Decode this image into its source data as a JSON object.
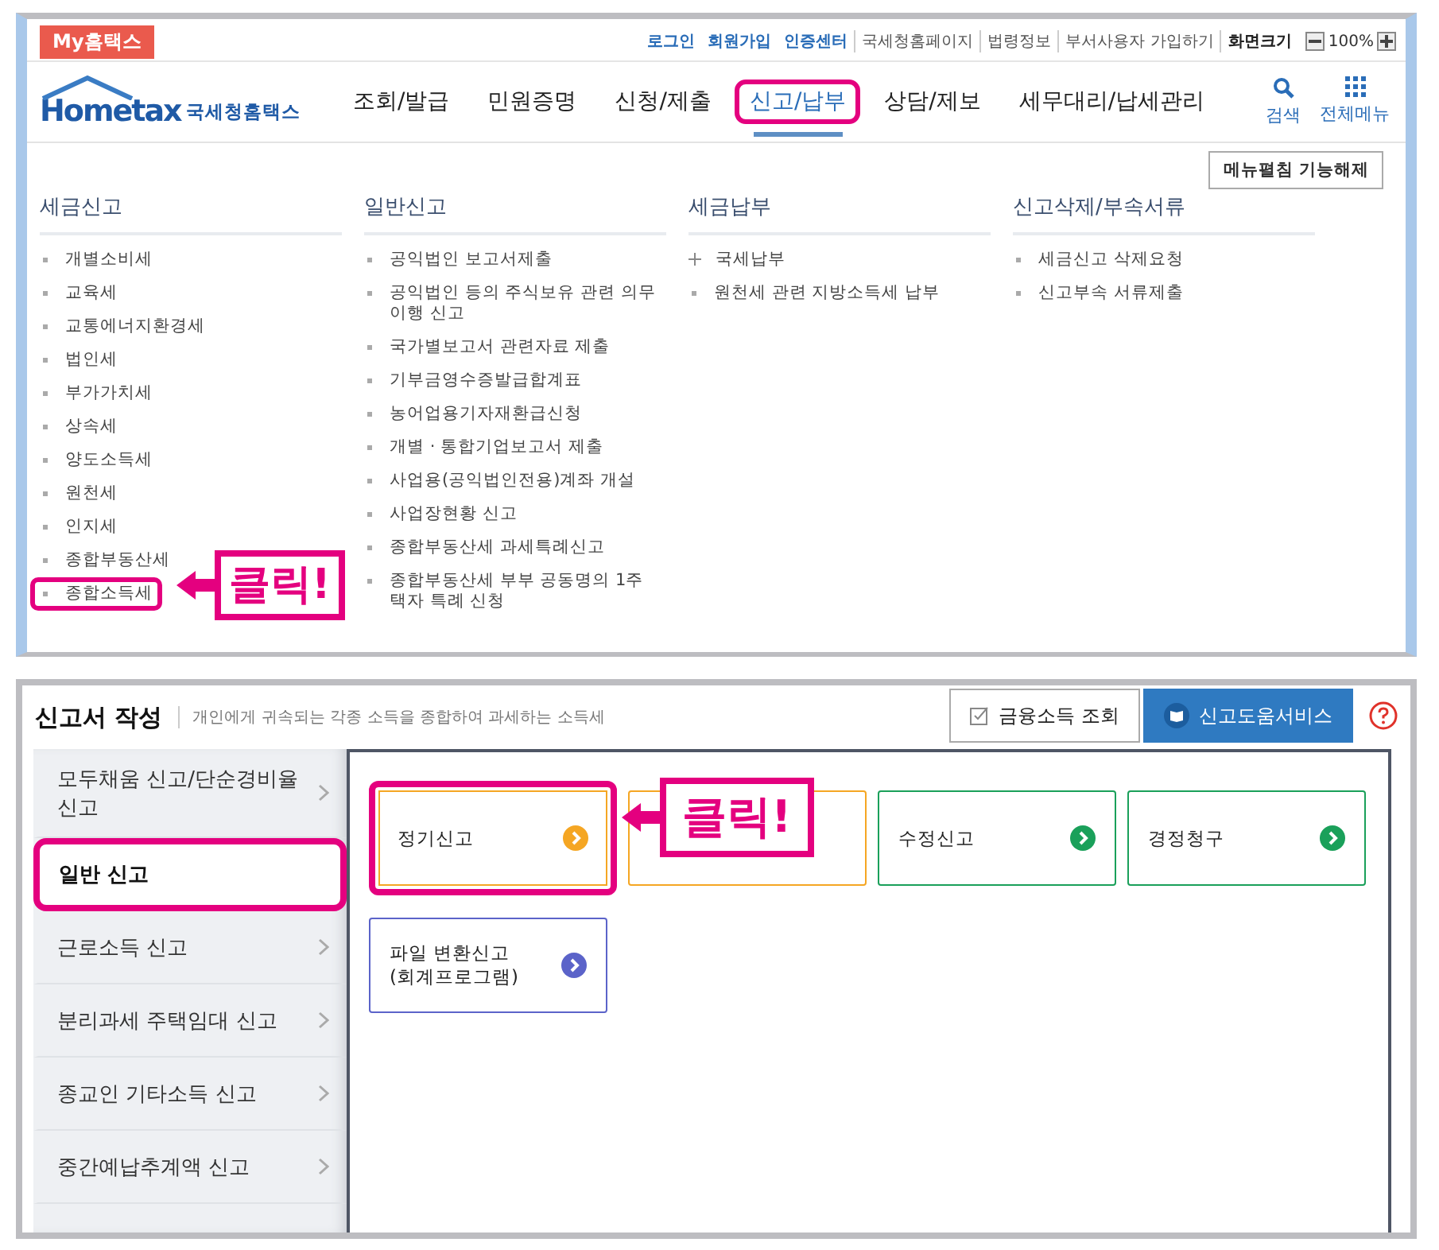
{
  "header": {
    "badge": "My홈택스",
    "top_links": [
      {
        "label": "로그인",
        "kind": "accent"
      },
      {
        "label": "회원가입",
        "kind": "accent"
      },
      {
        "label": "인증센터",
        "kind": "accent"
      },
      {
        "label": "국세청홈페이지",
        "kind": "plain"
      },
      {
        "label": "법령정보",
        "kind": "plain"
      },
      {
        "label": "부서사용자 가입하기",
        "kind": "plain"
      },
      {
        "label": "화면크기",
        "kind": "strong"
      }
    ],
    "zoom_value": "100%"
  },
  "logo": {
    "name": "Hometax",
    "korean": "국세청홈택스"
  },
  "nav": [
    {
      "label": "조회/발급",
      "selected": false,
      "highlighted": false
    },
    {
      "label": "민원증명",
      "selected": false,
      "highlighted": false
    },
    {
      "label": "신청/제출",
      "selected": false,
      "highlighted": false
    },
    {
      "label": "신고/납부",
      "selected": true,
      "highlighted": true
    },
    {
      "label": "상담/제보",
      "selected": false,
      "highlighted": false
    },
    {
      "label": "세무대리/납세관리",
      "selected": false,
      "highlighted": false
    }
  ],
  "tools": [
    {
      "label": "검색",
      "kind": "search"
    },
    {
      "label": "전체메뉴",
      "kind": "grid"
    }
  ],
  "menu_toggle": "메뉴펼침 기능해제",
  "menu_columns": [
    {
      "title": "세금신고",
      "items": [
        {
          "label": "개별소비세",
          "kind": "dot",
          "highlighted": false
        },
        {
          "label": "교육세",
          "kind": "dot",
          "highlighted": false
        },
        {
          "label": "교통에너지환경세",
          "kind": "dot",
          "highlighted": false
        },
        {
          "label": "법인세",
          "kind": "dot",
          "highlighted": false
        },
        {
          "label": "부가가치세",
          "kind": "dot",
          "highlighted": false
        },
        {
          "label": "상속세",
          "kind": "dot",
          "highlighted": false
        },
        {
          "label": "양도소득세",
          "kind": "dot",
          "highlighted": false
        },
        {
          "label": "원천세",
          "kind": "dot",
          "highlighted": false
        },
        {
          "label": "인지세",
          "kind": "dot",
          "highlighted": false
        },
        {
          "label": "종합부동산세",
          "kind": "dot",
          "highlighted": false
        },
        {
          "label": "종합소득세",
          "kind": "dot",
          "highlighted": true
        }
      ]
    },
    {
      "title": "일반신고",
      "items": [
        {
          "label": "공익법인 보고서제출",
          "kind": "dot",
          "highlighted": false
        },
        {
          "label": "공익법인 등의 주식보유 관련 의무이행 신고",
          "kind": "dot",
          "highlighted": false
        },
        {
          "label": "국가별보고서 관련자료 제출",
          "kind": "dot",
          "highlighted": false
        },
        {
          "label": "기부금영수증발급합계표",
          "kind": "dot",
          "highlighted": false
        },
        {
          "label": "농어업용기자재환급신청",
          "kind": "dot",
          "highlighted": false
        },
        {
          "label": "개별 · 통합기업보고서 제출",
          "kind": "dot",
          "highlighted": false
        },
        {
          "label": "사업용(공익법인전용)계좌 개설",
          "kind": "dot",
          "highlighted": false
        },
        {
          "label": "사업장현황 신고",
          "kind": "dot",
          "highlighted": false
        },
        {
          "label": "종합부동산세 과세특례신고",
          "kind": "dot",
          "highlighted": false
        },
        {
          "label": "종합부동산세 부부 공동명의 1주택자 특례 신청",
          "kind": "dot",
          "highlighted": false
        }
      ]
    },
    {
      "title": "세금납부",
      "items": [
        {
          "label": "국세납부",
          "kind": "plus",
          "highlighted": false
        },
        {
          "label": "원천세 관련 지방소득세 납부",
          "kind": "dot",
          "highlighted": false
        }
      ]
    },
    {
      "title": "신고삭제/부속서류",
      "items": [
        {
          "label": "세금신고 삭제요청",
          "kind": "dot",
          "highlighted": false
        },
        {
          "label": "신고부속 서류제출",
          "kind": "dot",
          "highlighted": false
        }
      ]
    }
  ],
  "callouts": [
    {
      "text": "클릭!"
    },
    {
      "text": "클릭!"
    }
  ],
  "form": {
    "title": "신고서 작성",
    "description": "개인에게 귀속되는 각종 소득을 종합하여 과세하는 소득세",
    "buttons": [
      {
        "label": "금융소득 조회",
        "kind": "check"
      },
      {
        "label": "신고도움서비스",
        "kind": "book"
      }
    ]
  },
  "side_menu": [
    {
      "label": "모두채움 신고/단순경비율 신고",
      "selected": false,
      "highlighted": false
    },
    {
      "label": "일반 신고",
      "selected": true,
      "highlighted": true
    },
    {
      "label": "근로소득 신고",
      "selected": false,
      "highlighted": false
    },
    {
      "label": "분리과세 주택임대 신고",
      "selected": false,
      "highlighted": false
    },
    {
      "label": "종교인 기타소득 신고",
      "selected": false,
      "highlighted": false
    },
    {
      "label": "중간예납추계액 신고",
      "selected": false,
      "highlighted": false
    }
  ],
  "cards": [
    {
      "label": "정기신고",
      "kind": "card",
      "color": "#f5a623",
      "highlighted": true
    },
    {
      "kind": "covered",
      "color": "#f5a623"
    },
    {
      "label": "수정신고",
      "kind": "card",
      "color": "#1aa05a",
      "highlighted": false
    },
    {
      "label": "경정청구",
      "kind": "card",
      "color": "#1aa05a",
      "highlighted": false
    },
    {
      "label": "파일 변환신고\n(회계프로그램)",
      "kind": "card",
      "color": "#5b63c9",
      "highlighted": false
    }
  ]
}
